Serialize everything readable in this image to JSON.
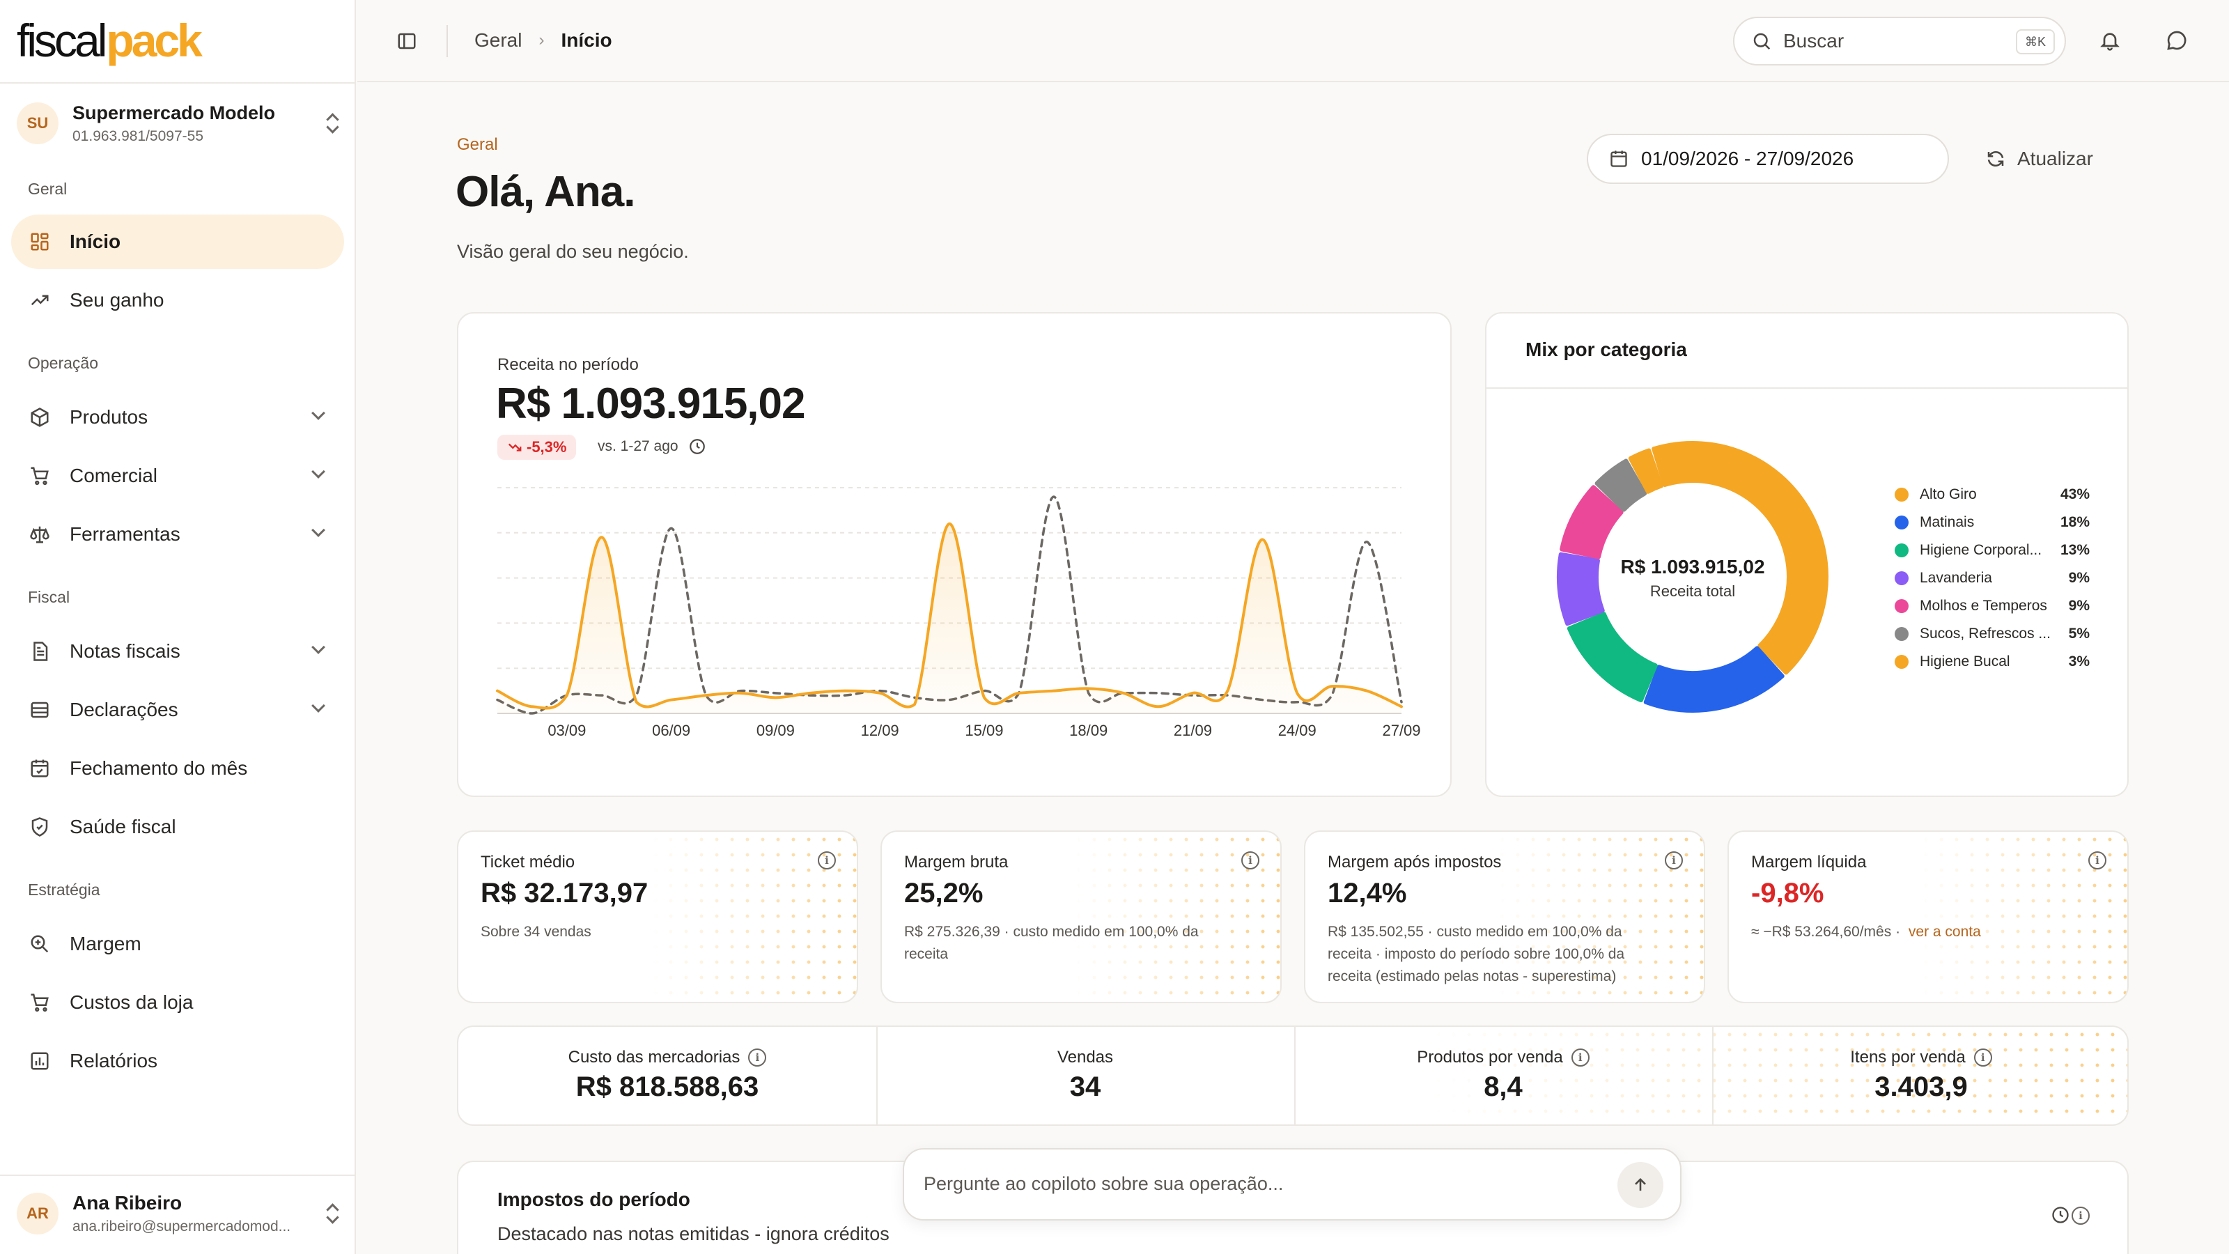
{
  "brand": {
    "part1": "fiscal",
    "part2": "pack"
  },
  "company": {
    "initials": "SU",
    "name": "Supermercado Modelo",
    "cnpj": "01.963.981/5097-55"
  },
  "sidebar": {
    "sections": [
      {
        "label": "Geral",
        "items": [
          {
            "label": "Início",
            "active": true
          },
          {
            "label": "Seu ganho"
          }
        ]
      },
      {
        "label": "Operação",
        "items": [
          {
            "label": "Produtos"
          },
          {
            "label": "Comercial"
          },
          {
            "label": "Ferramentas"
          }
        ]
      },
      {
        "label": "Fiscal",
        "items": [
          {
            "label": "Notas fiscais"
          },
          {
            "label": "Declarações"
          },
          {
            "label": "Fechamento do mês"
          },
          {
            "label": "Saúde fiscal"
          }
        ]
      },
      {
        "label": "Estratégia",
        "items": [
          {
            "label": "Margem"
          },
          {
            "label": "Custos da loja"
          },
          {
            "label": "Relatórios"
          }
        ]
      }
    ]
  },
  "user": {
    "initials": "AR",
    "name": "Ana Ribeiro",
    "email": "ana.ribeiro@supermercadomod..."
  },
  "topbar": {
    "breadcrumb": [
      "Geral",
      "Início"
    ],
    "search_placeholder": "Buscar",
    "search_shortcut": "⌘K"
  },
  "header": {
    "eyebrow": "Geral",
    "title": "Olá, Ana.",
    "subtitle": "Visão geral do seu negócio.",
    "date_range": "01/09/2026 - 27/09/2026",
    "refresh_label": "Atualizar"
  },
  "revenue": {
    "label": "Receita no período",
    "value": "R$ 1.093.915,02",
    "delta": "-5,3%",
    "compare": "vs. 1-27 ago"
  },
  "chart_data": {
    "type": "line",
    "x": [
      "01/09",
      "02/09",
      "03/09",
      "04/09",
      "05/09",
      "06/09",
      "07/09",
      "08/09",
      "09/09",
      "10/09",
      "11/09",
      "12/09",
      "13/09",
      "14/09",
      "15/09",
      "16/09",
      "17/09",
      "18/09",
      "19/09",
      "20/09",
      "21/09",
      "22/09",
      "23/09",
      "24/09",
      "25/09",
      "26/09",
      "27/09"
    ],
    "x_ticks": [
      "03/09",
      "06/09",
      "09/09",
      "12/09",
      "15/09",
      "18/09",
      "21/09",
      "24/09",
      "27/09"
    ],
    "series": [
      {
        "color": "#f5a623",
        "style": "solid",
        "values": [
          10,
          3,
          8,
          78,
          5,
          6,
          8,
          9,
          7,
          9,
          10,
          9,
          4,
          84,
          7,
          9,
          10,
          11,
          9,
          3,
          9,
          10,
          77,
          9,
          12,
          10,
          3
        ]
      },
      {
        "color": "#6b6762",
        "style": "dashed",
        "values": [
          6,
          0,
          8,
          8,
          8,
          82,
          8,
          10,
          9,
          8,
          8,
          10,
          7,
          6,
          10,
          9,
          96,
          9,
          9,
          9,
          8,
          8,
          6,
          5,
          8,
          76,
          5
        ]
      }
    ],
    "ylim": [
      0,
      100
    ],
    "grid": true
  },
  "mix": {
    "title": "Mix por categoria",
    "center_value": "R$ 1.093.915,02",
    "center_label": "Receita total",
    "categories": [
      {
        "name": "Alto Giro",
        "pct": "43%",
        "value": 43,
        "color": "#f5a623"
      },
      {
        "name": "Matinais",
        "pct": "18%",
        "value": 18,
        "color": "#2563eb"
      },
      {
        "name": "Higiene Corporal...",
        "pct": "13%",
        "value": 13,
        "color": "#10b981"
      },
      {
        "name": "Lavanderia",
        "pct": "9%",
        "value": 9,
        "color": "#8b5cf6"
      },
      {
        "name": "Molhos e Temperos",
        "pct": "9%",
        "value": 9,
        "color": "#ec4899"
      },
      {
        "name": "Sucos, Refrescos ...",
        "pct": "5%",
        "value": 5,
        "color": "#888888"
      },
      {
        "name": "Higiene Bucal",
        "pct": "3%",
        "value": 3,
        "color": "#f5a623"
      }
    ]
  },
  "kpis": [
    {
      "title": "Ticket médio",
      "value": "R$ 32.173,97",
      "sub": "Sobre 34 vendas"
    },
    {
      "title": "Margem bruta",
      "value": "25,2%",
      "sub": "R$ 275.326,39 · custo medido em 100,0% da receita"
    },
    {
      "title": "Margem após impostos",
      "value": "12,4%",
      "sub": "R$ 135.502,55 · custo medido em 100,0% da receita · imposto do período sobre 100,0% da receita (estimado pelas notas - superestima)"
    },
    {
      "title": "Margem líquida",
      "value": "-9,8%",
      "sub": "≈ −R$ 53.264,60/mês ·",
      "link": "ver a conta"
    }
  ],
  "stats": [
    {
      "title": "Custo das mercadorias",
      "value": "R$ 818.588,63"
    },
    {
      "title": "Vendas",
      "value": "34"
    },
    {
      "title": "Produtos por venda",
      "value": "8,4"
    },
    {
      "title": "Itens por venda",
      "value": "3.403,9"
    }
  ],
  "taxes": {
    "title": "Impostos do período",
    "subtitle": "Destacado nas notas emitidas - ignora créditos"
  },
  "copilot": {
    "placeholder": "Pergunte ao copiloto sobre sua operação..."
  },
  "colors": {
    "accent": "#f5a623",
    "negative": "#dc2626",
    "eyebrow": "#b5651d"
  }
}
